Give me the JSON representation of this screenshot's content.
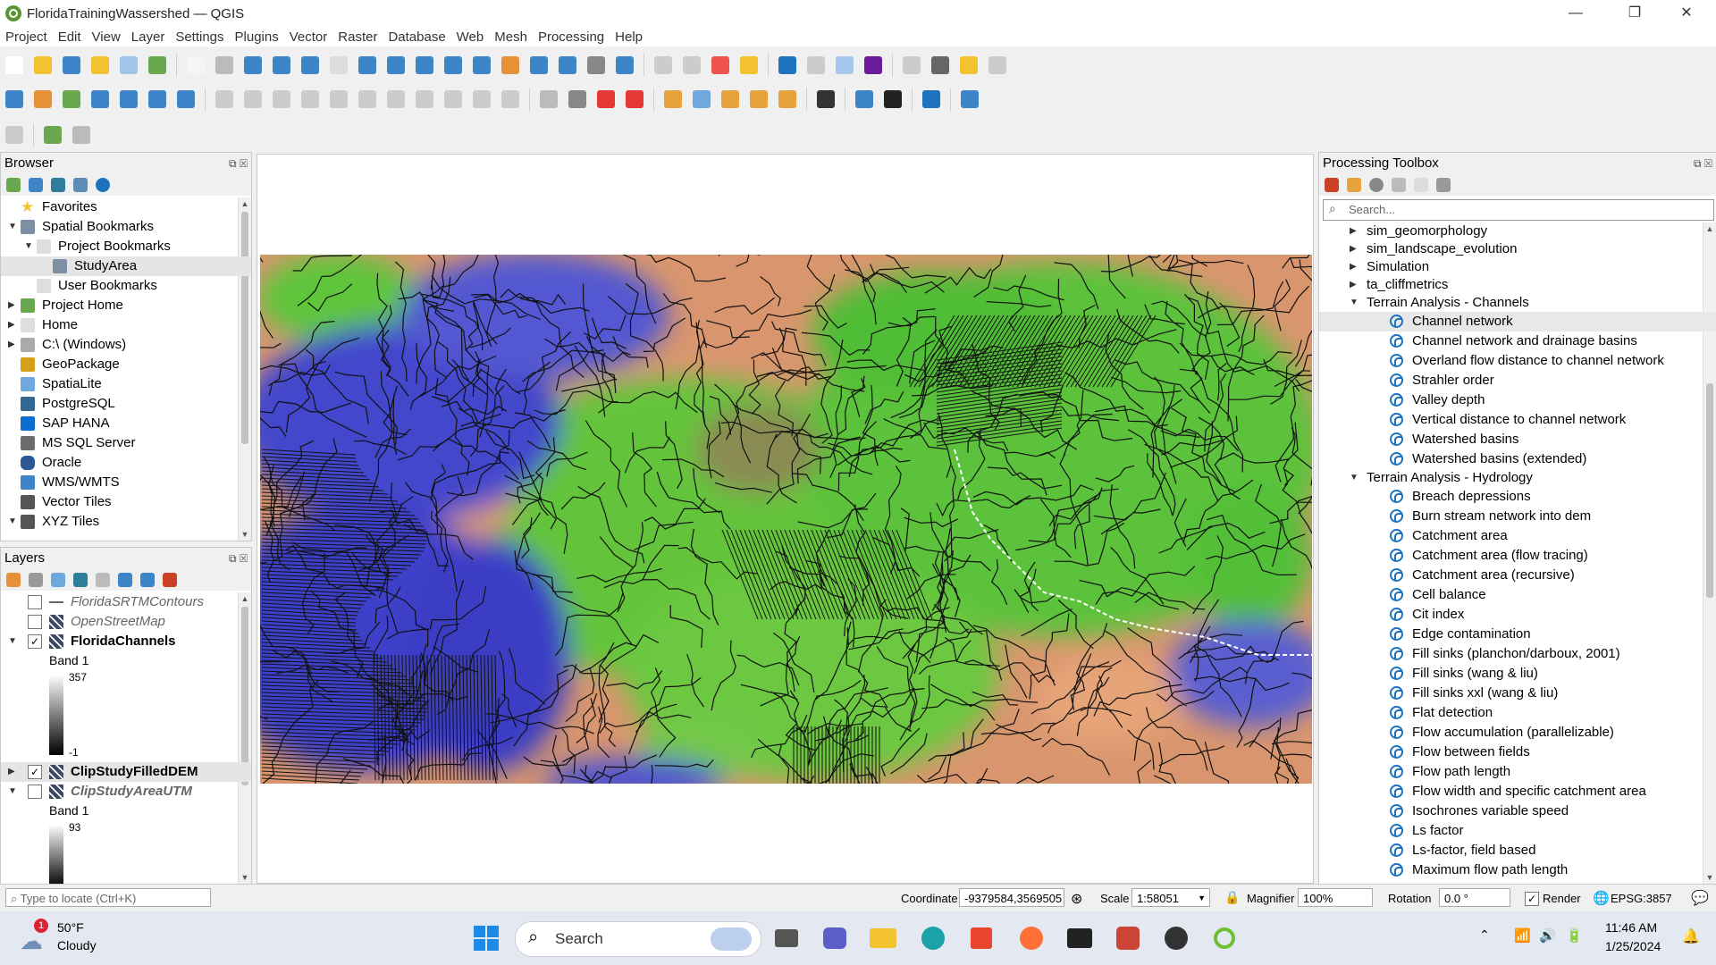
{
  "window": {
    "title": "FloridaTrainingWassershed — QGIS",
    "controls": [
      "—",
      "❐",
      "✕"
    ]
  },
  "menu": [
    "Project",
    "Edit",
    "View",
    "Layer",
    "Settings",
    "Plugins",
    "Vector",
    "Raster",
    "Database",
    "Web",
    "Mesh",
    "Processing",
    "Help"
  ],
  "browser": {
    "title": "Browser",
    "items": [
      {
        "label": "Favorites",
        "icon": "star-icon",
        "depth": 0,
        "arrow": ""
      },
      {
        "label": "Spatial Bookmarks",
        "icon": "bookmark-icon",
        "depth": 0,
        "arrow": "down"
      },
      {
        "label": "Project Bookmarks",
        "icon": "folder-icon",
        "depth": 1,
        "arrow": "down"
      },
      {
        "label": "StudyArea",
        "icon": "bookmark-icon",
        "depth": 2,
        "arrow": "",
        "selected": true
      },
      {
        "label": "User Bookmarks",
        "icon": "folder-icon",
        "depth": 1,
        "arrow": ""
      },
      {
        "label": "Project Home",
        "icon": "folder-green-icon",
        "depth": 0,
        "arrow": "right"
      },
      {
        "label": "Home",
        "icon": "folder-icon",
        "depth": 0,
        "arrow": "right"
      },
      {
        "label": "C:\\ (Windows)",
        "icon": "drive-icon",
        "depth": 0,
        "arrow": "right"
      },
      {
        "label": "GeoPackage",
        "icon": "geopackage-icon",
        "depth": 0,
        "arrow": ""
      },
      {
        "label": "SpatiaLite",
        "icon": "spatialite-icon",
        "depth": 0,
        "arrow": ""
      },
      {
        "label": "PostgreSQL",
        "icon": "postgresql-icon",
        "depth": 0,
        "arrow": ""
      },
      {
        "label": "SAP HANA",
        "icon": "hana-icon",
        "depth": 0,
        "arrow": ""
      },
      {
        "label": "MS SQL Server",
        "icon": "mssql-icon",
        "depth": 0,
        "arrow": ""
      },
      {
        "label": "Oracle",
        "icon": "oracle-icon",
        "depth": 0,
        "arrow": ""
      },
      {
        "label": "WMS/WMTS",
        "icon": "globe-icon",
        "depth": 0,
        "arrow": ""
      },
      {
        "label": "Vector Tiles",
        "icon": "grid-icon",
        "depth": 0,
        "arrow": ""
      },
      {
        "label": "XYZ Tiles",
        "icon": "grid-icon",
        "depth": 0,
        "arrow": "down"
      }
    ]
  },
  "layers": {
    "title": "Layers",
    "items": [
      {
        "label": "FloridaSRTMContours",
        "type": "line",
        "checked": false,
        "bold": false,
        "italic": true,
        "arrow": ""
      },
      {
        "label": "OpenStreetMap",
        "type": "raster",
        "checked": false,
        "bold": false,
        "italic": true,
        "arrow": ""
      },
      {
        "label": "FloridaChannels",
        "type": "raster",
        "checked": true,
        "bold": true,
        "italic": false,
        "arrow": "down"
      },
      {
        "label": "Band 1",
        "type": "band",
        "max": "357",
        "min": "-1"
      },
      {
        "label": "ClipStudyFilledDEM",
        "type": "raster",
        "checked": true,
        "bold": true,
        "italic": false,
        "arrow": "right",
        "selected": true
      },
      {
        "label": "ClipStudyAreaUTM",
        "type": "raster",
        "checked": false,
        "bold": true,
        "italic": true,
        "arrow": "down"
      },
      {
        "label": "Band 1",
        "type": "band",
        "max": "93",
        "min": ""
      }
    ]
  },
  "processing": {
    "title": "Processing Toolbox",
    "search_placeholder": "Search...",
    "groups": [
      {
        "label": "sim_geomorphology",
        "expanded": false,
        "items": []
      },
      {
        "label": "sim_landscape_evolution",
        "expanded": false,
        "items": []
      },
      {
        "label": "Simulation",
        "expanded": false,
        "items": []
      },
      {
        "label": "ta_cliffmetrics",
        "expanded": false,
        "items": []
      },
      {
        "label": "Terrain Analysis - Channels",
        "expanded": true,
        "items": [
          "Channel network",
          "Channel network and drainage basins",
          "Overland flow distance to channel network",
          "Strahler order",
          "Valley depth",
          "Vertical distance to channel network",
          "Watershed basins",
          "Watershed basins (extended)"
        ]
      },
      {
        "label": "Terrain Analysis - Hydrology",
        "expanded": true,
        "items": [
          "Breach depressions",
          "Burn stream network into dem",
          "Catchment area",
          "Catchment area (flow tracing)",
          "Catchment area (recursive)",
          "Cell balance",
          "Cit index",
          "Edge contamination",
          "Fill sinks (planchon/darboux, 2001)",
          "Fill sinks (wang & liu)",
          "Fill sinks xxl (wang & liu)",
          "Flat detection",
          "Flow accumulation (parallelizable)",
          "Flow between fields",
          "Flow path length",
          "Flow width and specific catchment area",
          "Isochrones variable speed",
          "Ls factor",
          "Ls-factor, field based",
          "Maximum flow path length"
        ]
      }
    ]
  },
  "status": {
    "locate_placeholder": "Type to locate (Ctrl+K)",
    "coordinate_label": "Coordinate",
    "coordinate_value": "-9379584,3569505",
    "scale_label": "Scale",
    "scale_value": "1:58051",
    "magnifier_label": "Magnifier",
    "magnifier_value": "100%",
    "rotation_label": "Rotation",
    "rotation_value": "0.0 °",
    "render_label": "Render",
    "crs_label": "EPSG:3857"
  },
  "taskbar": {
    "weather_temp": "50°F",
    "weather_desc": "Cloudy",
    "weather_badge": "1",
    "search_label": "Search",
    "time": "11:46 AM",
    "date": "1/25/2024"
  },
  "colors": {
    "accent": "#1e73be",
    "qgis_green": "#589632",
    "water_blue": "#3d43c8",
    "land_green": "#4ec93a",
    "dem_orange": "#e0a07a"
  }
}
